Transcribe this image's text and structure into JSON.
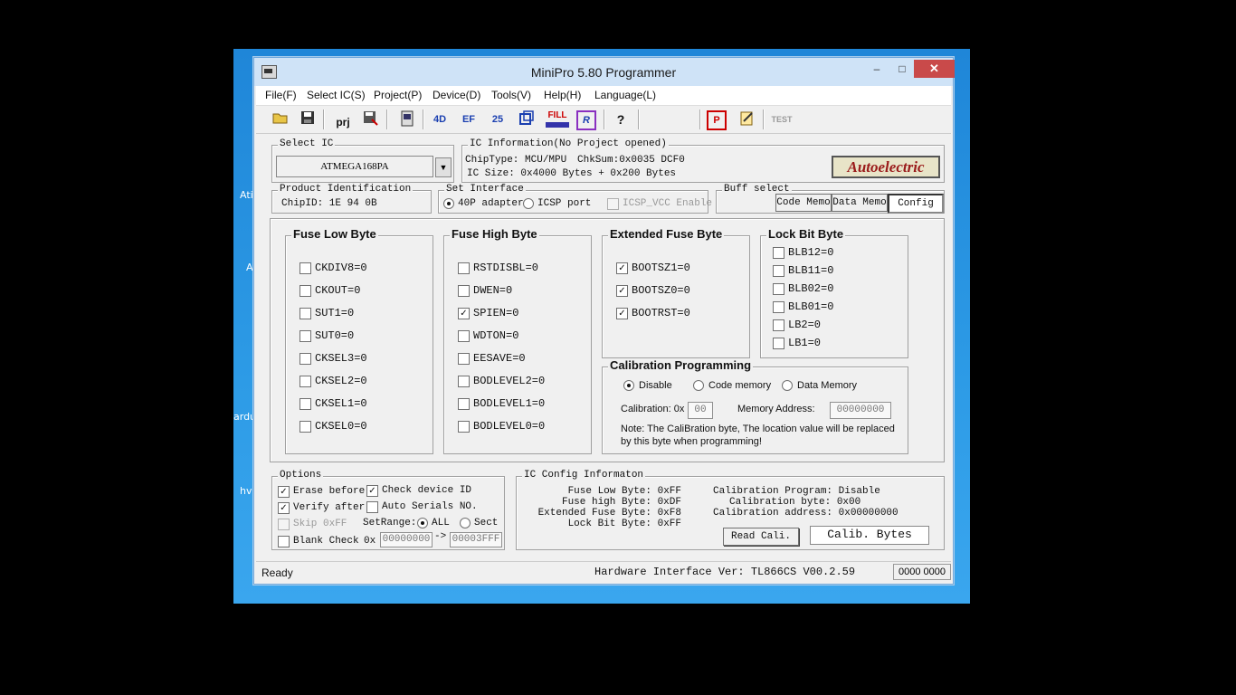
{
  "window": {
    "title": "MiniPro 5.80 Programmer",
    "min": "–",
    "max": "□",
    "close": "✕"
  },
  "desktop_fragments": [
    "Ati",
    "A",
    "ardu",
    "hv"
  ],
  "menu": [
    "File(F)",
    "Select IC(S)",
    "Project(P)",
    "Device(D)",
    "Tools(V)",
    "Help(H)",
    "Language(L)"
  ],
  "toolbar": {
    "prj": "prj",
    "fill": "FILL",
    "test": "TEST"
  },
  "select_ic": {
    "legend": "Select IC",
    "value": "ATMEGA168PA"
  },
  "ic_info": {
    "legend": "IC Information(No Project opened)",
    "chip_type": "ChipType:  MCU/MPU",
    "chksum": "ChkSum:0x0035 DCF0",
    "ic_size": "IC Size:  0x4000 Bytes + 0x200 Bytes",
    "logo": "Autoelectric"
  },
  "product": {
    "legend": "Product Identification",
    "chip_id": "ChipID: 1E 94 0B"
  },
  "interface": {
    "legend": "Set Interface",
    "opt1": "40P adapter",
    "opt2": "ICSP port",
    "icsp_vcc": "ICSP_VCC Enable"
  },
  "buff": {
    "legend": "Buff select",
    "code": "Code Memo",
    "data": "Data Memo",
    "config": "Config"
  },
  "fuse_low": {
    "title": "Fuse Low Byte",
    "items": [
      {
        "label": "CKDIV8=0",
        "checked": false
      },
      {
        "label": "CKOUT=0",
        "checked": false
      },
      {
        "label": "SUT1=0",
        "checked": false
      },
      {
        "label": "SUT0=0",
        "checked": false
      },
      {
        "label": "CKSEL3=0",
        "checked": false
      },
      {
        "label": "CKSEL2=0",
        "checked": false
      },
      {
        "label": "CKSEL1=0",
        "checked": false
      },
      {
        "label": "CKSEL0=0",
        "checked": false
      }
    ]
  },
  "fuse_high": {
    "title": "Fuse High Byte",
    "items": [
      {
        "label": "RSTDISBL=0",
        "checked": false
      },
      {
        "label": "DWEN=0",
        "checked": false
      },
      {
        "label": "SPIEN=0",
        "checked": true
      },
      {
        "label": "WDTON=0",
        "checked": false
      },
      {
        "label": "EESAVE=0",
        "checked": false
      },
      {
        "label": "BODLEVEL2=0",
        "checked": false
      },
      {
        "label": "BODLEVEL1=0",
        "checked": false
      },
      {
        "label": "BODLEVEL0=0",
        "checked": false
      }
    ]
  },
  "ext_fuse": {
    "title": "Extended Fuse Byte",
    "items": [
      {
        "label": "BOOTSZ1=0",
        "checked": true
      },
      {
        "label": "BOOTSZ0=0",
        "checked": true
      },
      {
        "label": "BOOTRST=0",
        "checked": true
      }
    ]
  },
  "lock_bits": {
    "title": "Lock Bit Byte",
    "items": [
      {
        "label": "BLB12=0",
        "checked": false
      },
      {
        "label": "BLB11=0",
        "checked": false
      },
      {
        "label": "BLB02=0",
        "checked": false
      },
      {
        "label": "BLB01=0",
        "checked": false
      },
      {
        "label": "LB2=0",
        "checked": false
      },
      {
        "label": "LB1=0",
        "checked": false
      }
    ]
  },
  "calib": {
    "title": "Calibration Programming",
    "disable": "Disable",
    "code": "Code memory",
    "data": "Data Memory",
    "cal_label": "Calibration: 0x",
    "cal_value": "00",
    "mem_label": "Memory Address:",
    "mem_value": "00000000",
    "note1": "Note: The CaliBration byte,  The location value will be replaced",
    "note2": "by this byte  when programming!"
  },
  "options": {
    "legend": "Options",
    "erase": "Erase before",
    "check_id": "Check device ID",
    "verify": "Verify after",
    "auto_serial": "Auto Serials NO.",
    "skip": "Skip 0xFF",
    "setrange": "SetRange:",
    "all": "ALL",
    "sect": "Sect",
    "blank": "Blank Check",
    "ox": "0x",
    "from": "00000000",
    "arrow": "->",
    "to": "00003FFF"
  },
  "config_info": {
    "legend": "IC Config Informaton",
    "fl": "Fuse Low Byte: 0xFF",
    "fh": "Fuse high Byte: 0xDF",
    "fe": "Extended Fuse Byte: 0xF8",
    "lb": "Lock Bit Byte: 0xFF",
    "cp": "Calibration Program: Disable",
    "cb": "Calibration byte: 0x00",
    "ca": "Calibration address: 0x00000000",
    "read_btn": "Read Cali.",
    "calib_btn": "Calib. Bytes"
  },
  "status": {
    "ready": "Ready",
    "hw": "Hardware Interface Ver: TL866CS V00.2.59",
    "code": "0000 0000"
  }
}
